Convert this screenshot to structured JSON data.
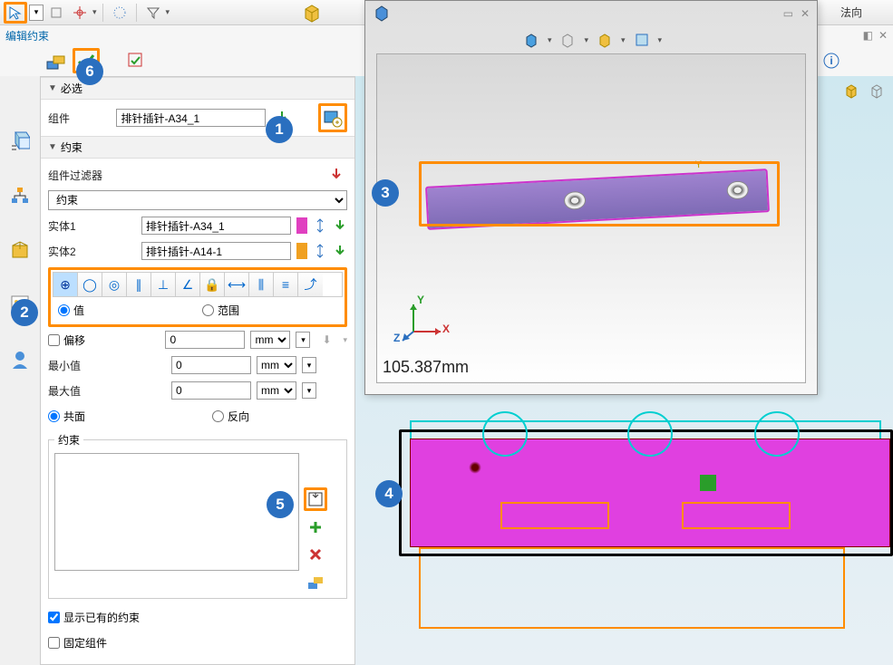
{
  "toolbar": {
    "right_label": "法向"
  },
  "panel": {
    "title": "编辑约束",
    "section_required": "必选",
    "component_label": "组件",
    "component_value": "排针插针-A34_1",
    "section_constraint": "约束",
    "filter_label": "组件过滤器",
    "constraint_dropdown": "约束",
    "body1_label": "实体1",
    "body1_value": "排针插针-A34_1",
    "body2_label": "实体2",
    "body2_value": "排针插针-A14-1",
    "value_label": "值",
    "range_label": "范围",
    "offset_label": "偏移",
    "offset_value": "0",
    "min_label": "最小值",
    "min_value": "0",
    "max_label": "最大值",
    "max_value": "0",
    "unit": "mm",
    "coplane_label": "共面",
    "reverse_label": "反向",
    "constraint_list_label": "约束",
    "show_existing": "显示已有的约束",
    "fix_label": "固定组件"
  },
  "preview": {
    "status": "105.387mm"
  },
  "callouts": {
    "c1": "1",
    "c2": "2",
    "c3": "3",
    "c4": "4",
    "c5": "5",
    "c6": "6"
  },
  "axes": {
    "x": "X",
    "y": "Y",
    "z": "Z"
  }
}
